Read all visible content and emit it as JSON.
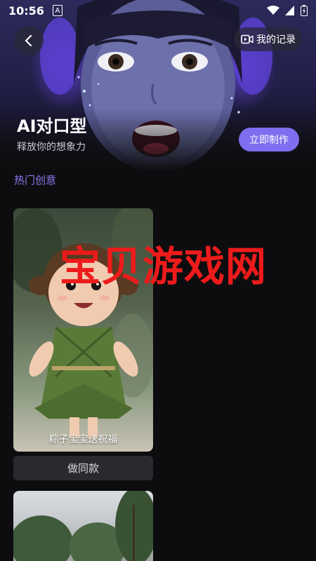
{
  "status_bar": {
    "time": "10:56",
    "badge": "A"
  },
  "header": {
    "back_icon": "chevron-left-icon",
    "records_icon": "video-record-icon",
    "records_label": "我的记录",
    "title": "AI对口型",
    "subtitle": "释放你的想象力",
    "make_button": "立即制作"
  },
  "section": {
    "label": "热门创意"
  },
  "cards": [
    {
      "caption": "粽子宝宝送祝福",
      "action": "做同款"
    }
  ],
  "watermark": "宝贝游戏网",
  "colors": {
    "accent": "#7f6ef0",
    "section_label": "#8a7bf0",
    "watermark": "#ee1b1b",
    "background": "#0d0d0f"
  }
}
